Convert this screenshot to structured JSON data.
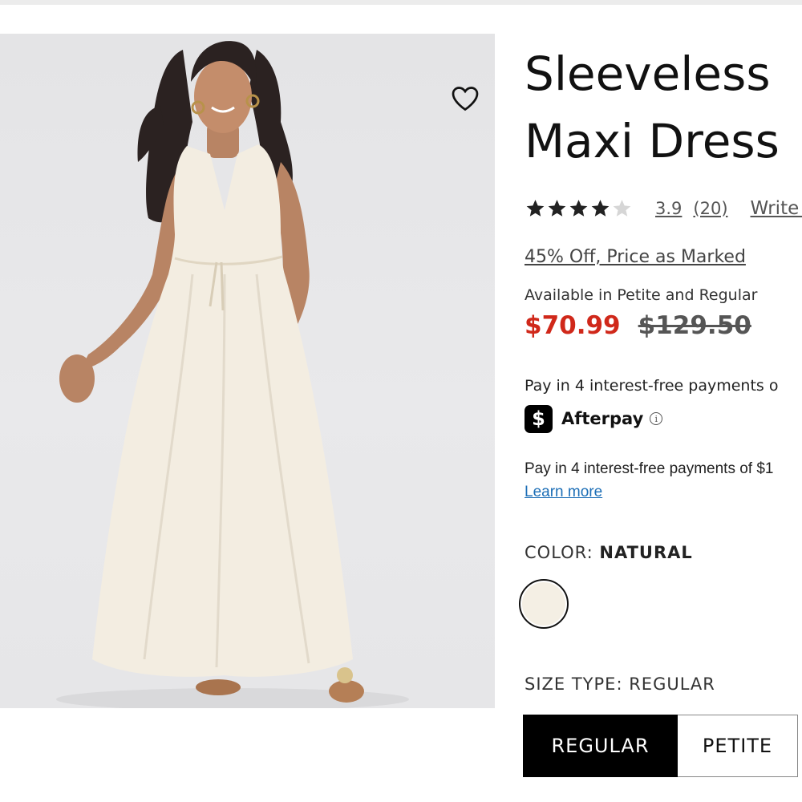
{
  "product": {
    "title_line1": "Sleeveless",
    "title_line2": "Maxi Dress",
    "image_alt": "Woman wearing a natural sleeveless maxi dress",
    "wishlist_icon": "heart-outline-icon"
  },
  "rating": {
    "stars": 4,
    "max_stars": 5,
    "average": "3.9",
    "count": "(20)",
    "write_review": "Write a"
  },
  "promo": {
    "text": "45% Off, Price as Marked"
  },
  "availability": "Available in Petite and Regular",
  "price": {
    "sale": "$70.99",
    "original": "$129.50",
    "sale_color": "#d0281a"
  },
  "afterpay": {
    "text": "Pay in 4 interest-free payments o",
    "logo_glyph": "$",
    "name": "Afterpay",
    "info_glyph": "i"
  },
  "klarna": {
    "text": "Pay in 4 interest-free payments of $1",
    "learn_more": "Learn more"
  },
  "color": {
    "label": "COLOR:",
    "value": "NATURAL",
    "swatch_color": "#f4efe4"
  },
  "size_type": {
    "label": "SIZE TYPE:",
    "value": "REGULAR",
    "options": [
      "REGULAR",
      "PETITE"
    ]
  }
}
